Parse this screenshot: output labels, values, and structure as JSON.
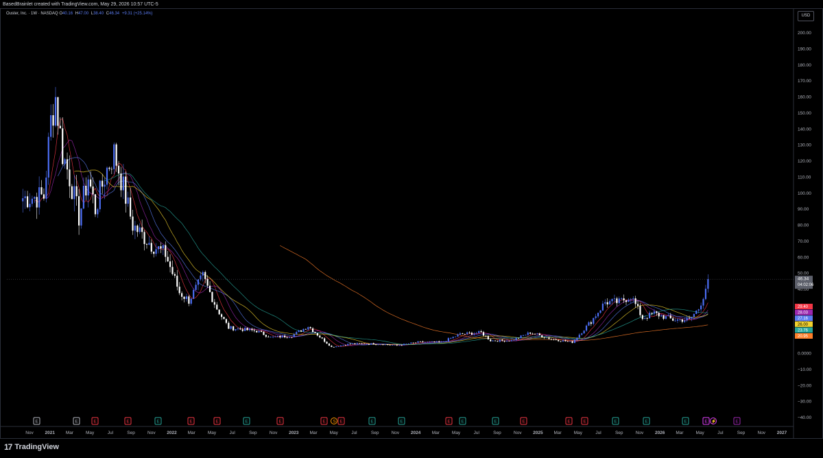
{
  "header": {
    "attribution": "BasedBrainlet created with TradingView.com, May 29, 2026 10:57 UTC-5"
  },
  "legend": {
    "symbol": "Ouster, Inc. · 1W · NASDAQ",
    "open_label": "O",
    "open": "40.16",
    "high_label": "H",
    "high": "47.00",
    "low_label": "L",
    "low": "38.40",
    "close_label": "C",
    "close": "46.34",
    "change": "+9.31 (+25.14%)"
  },
  "currency_button": "USD",
  "footer": {
    "brand": "TradingView",
    "brand_mark": "17"
  },
  "colors": {
    "up": "#4c6ef5",
    "down": "#ffffff",
    "ma_red": "#f23645",
    "ma_purple": "#9c27b0",
    "ma_blue": "#5b7cf2",
    "ma_yellow": "#f2d22e",
    "ma_teal": "#26a69a",
    "ma_orange": "#ff7f2a"
  },
  "price_badges": {
    "last_price": "46.34",
    "countdown": "04:02:06",
    "ma_values": [
      {
        "label": "29.40",
        "color": "#f23645"
      },
      {
        "label": "28.03",
        "color": "#9c27b0"
      },
      {
        "label": "27.16",
        "color": "#5b7cf2"
      },
      {
        "label": "26.00",
        "color": "#f2d22e"
      },
      {
        "label": "23.76",
        "color": "#26a69a"
      },
      {
        "label": "20.95",
        "color": "#ff7f2a"
      }
    ]
  },
  "events": [
    {
      "label": "E",
      "color": "#b2b5be",
      "x_label": "Nov"
    },
    {
      "label": "E",
      "color": "#b2b5be",
      "x_label": "Mar"
    },
    {
      "label": "E",
      "color": "#f23645",
      "x_label": "May"
    },
    {
      "label": "E",
      "color": "#f23645",
      "x_label": "Jul"
    },
    {
      "label": "E",
      "color": "#26a69a",
      "x_label": "Nov"
    },
    {
      "label": "E",
      "color": "#f23645",
      "x_label": "Mar"
    },
    {
      "label": "E",
      "color": "#f23645",
      "x_label": "May"
    },
    {
      "label": "E",
      "color": "#26a69a",
      "x_label": "Aug"
    },
    {
      "label": "E",
      "color": "#f23645",
      "x_label": "Nov"
    },
    {
      "label": "E",
      "color": "#f23645",
      "x_label": "Mar"
    },
    {
      "label": "S",
      "color": "#ff9800",
      "x_label": "Apr"
    },
    {
      "label": "E",
      "color": "#f23645",
      "x_label": "May"
    },
    {
      "label": "E",
      "color": "#26a69a",
      "x_label": "Aug"
    },
    {
      "label": "E",
      "color": "#26a69a",
      "x_label": "Nov"
    },
    {
      "label": "E",
      "color": "#f23645",
      "x_label": "Mar"
    },
    {
      "label": "E",
      "color": "#26a69a",
      "x_label": "May"
    },
    {
      "label": "E",
      "color": "#26a69a",
      "x_label": "Aug"
    },
    {
      "label": "E",
      "color": "#f23645",
      "x_label": "Nov"
    },
    {
      "label": "E",
      "color": "#f23645",
      "x_label": "Mar"
    },
    {
      "label": "E",
      "color": "#f23645",
      "x_label": "May"
    },
    {
      "label": "E",
      "color": "#26a69a",
      "x_label": "Aug"
    },
    {
      "label": "E",
      "color": "#26a69a",
      "x_label": "Nov"
    },
    {
      "label": "E",
      "color": "#26a69a",
      "x_label": "Mar"
    },
    {
      "label": "E",
      "color": "#e040fb",
      "x_label": "May"
    },
    {
      "label": "⚡",
      "color": "#e040fb",
      "x_label": "May"
    },
    {
      "label": "E",
      "color": "#9c27b0",
      "x_label": "Jul"
    }
  ],
  "chart_data": {
    "type": "candlestick",
    "title": "Ouster, Inc. · 1W · NASDAQ",
    "ylim": [
      -40,
      205
    ],
    "y_ticks": [
      200,
      190,
      180,
      170,
      160,
      150,
      140,
      130,
      120,
      110,
      100,
      90,
      80,
      70,
      60,
      50,
      40,
      30,
      20,
      10,
      0,
      -10,
      -20,
      -30,
      -40
    ],
    "y_tick_labels": [
      "200.00",
      "190.00",
      "180.00",
      "170.00",
      "160.00",
      "150.00",
      "140.00",
      "130.00",
      "120.00",
      "110.00",
      "100.00",
      "90.00",
      "80.00",
      "70.00",
      "60.00",
      "50.00",
      "40.00",
      "30.00",
      "20.00",
      "10.00",
      "0.0000",
      "−10.00",
      "−20.00",
      "−30.00",
      "−40.00"
    ],
    "x_ticks": [
      "Nov",
      "2021",
      "Mar",
      "May",
      "Jul",
      "Sep",
      "Nov",
      "2022",
      "Mar",
      "May",
      "Jul",
      "Sep",
      "Nov",
      "2023",
      "Mar",
      "May",
      "Jul",
      "Sep",
      "Nov",
      "2024",
      "Mar",
      "May",
      "Jul",
      "Sep",
      "Nov",
      "2025",
      "Mar",
      "May",
      "Jul",
      "Sep",
      "Nov",
      "2026",
      "Mar",
      "May",
      "Jul",
      "Sep",
      "Nov",
      "2027"
    ],
    "price_anchors": [
      {
        "date": "2020-10-12",
        "price": 97
      },
      {
        "date": "2020-12-14",
        "price": 98
      },
      {
        "date": "2021-01-04",
        "price": 145
      },
      {
        "date": "2021-01-18",
        "price": 160
      },
      {
        "date": "2021-02-08",
        "price": 125
      },
      {
        "date": "2021-03-01",
        "price": 110
      },
      {
        "date": "2021-03-29",
        "price": 85
      },
      {
        "date": "2021-04-26",
        "price": 110
      },
      {
        "date": "2021-05-17",
        "price": 90
      },
      {
        "date": "2021-06-21",
        "price": 115
      },
      {
        "date": "2021-07-12",
        "price": 125
      },
      {
        "date": "2021-07-26",
        "price": 115
      },
      {
        "date": "2021-09-06",
        "price": 80
      },
      {
        "date": "2021-11-01",
        "price": 68
      },
      {
        "date": "2021-12-13",
        "price": 62
      },
      {
        "date": "2022-01-24",
        "price": 38
      },
      {
        "date": "2022-02-21",
        "price": 33
      },
      {
        "date": "2022-04-04",
        "price": 48
      },
      {
        "date": "2022-05-16",
        "price": 28
      },
      {
        "date": "2022-06-20",
        "price": 16
      },
      {
        "date": "2022-09-12",
        "price": 14
      },
      {
        "date": "2022-10-24",
        "price": 10
      },
      {
        "date": "2022-12-26",
        "price": 11
      },
      {
        "date": "2023-02-13",
        "price": 17
      },
      {
        "date": "2023-03-27",
        "price": 9
      },
      {
        "date": "2023-04-24",
        "price": 4
      },
      {
        "date": "2023-06-19",
        "price": 6
      },
      {
        "date": "2023-09-04",
        "price": 6
      },
      {
        "date": "2023-11-06",
        "price": 5
      },
      {
        "date": "2024-01-08",
        "price": 7
      },
      {
        "date": "2024-03-18",
        "price": 7
      },
      {
        "date": "2024-05-13",
        "price": 12
      },
      {
        "date": "2024-07-15",
        "price": 13
      },
      {
        "date": "2024-08-12",
        "price": 8
      },
      {
        "date": "2024-10-14",
        "price": 8
      },
      {
        "date": "2024-12-09",
        "price": 13
      },
      {
        "date": "2025-02-10",
        "price": 9
      },
      {
        "date": "2025-04-14",
        "price": 7
      },
      {
        "date": "2025-06-09",
        "price": 20
      },
      {
        "date": "2025-07-21",
        "price": 32
      },
      {
        "date": "2025-09-01",
        "price": 32
      },
      {
        "date": "2025-10-06",
        "price": 36
      },
      {
        "date": "2025-11-10",
        "price": 22
      },
      {
        "date": "2025-12-15",
        "price": 25
      },
      {
        "date": "2026-02-09",
        "price": 21
      },
      {
        "date": "2026-03-30",
        "price": 21
      },
      {
        "date": "2026-04-27",
        "price": 28
      },
      {
        "date": "2026-05-11",
        "price": 36
      },
      {
        "date": "2026-05-25",
        "price": 46.34
      }
    ],
    "moving_averages": [
      {
        "color": "#f23645",
        "last": 29.4
      },
      {
        "color": "#9c27b0",
        "last": 28.03
      },
      {
        "color": "#5b7cf2",
        "last": 27.16
      },
      {
        "color": "#f2d22e",
        "last": 26.0
      },
      {
        "color": "#26a69a",
        "last": 23.76
      },
      {
        "color": "#ff7f2a",
        "last": 20.95
      }
    ]
  }
}
